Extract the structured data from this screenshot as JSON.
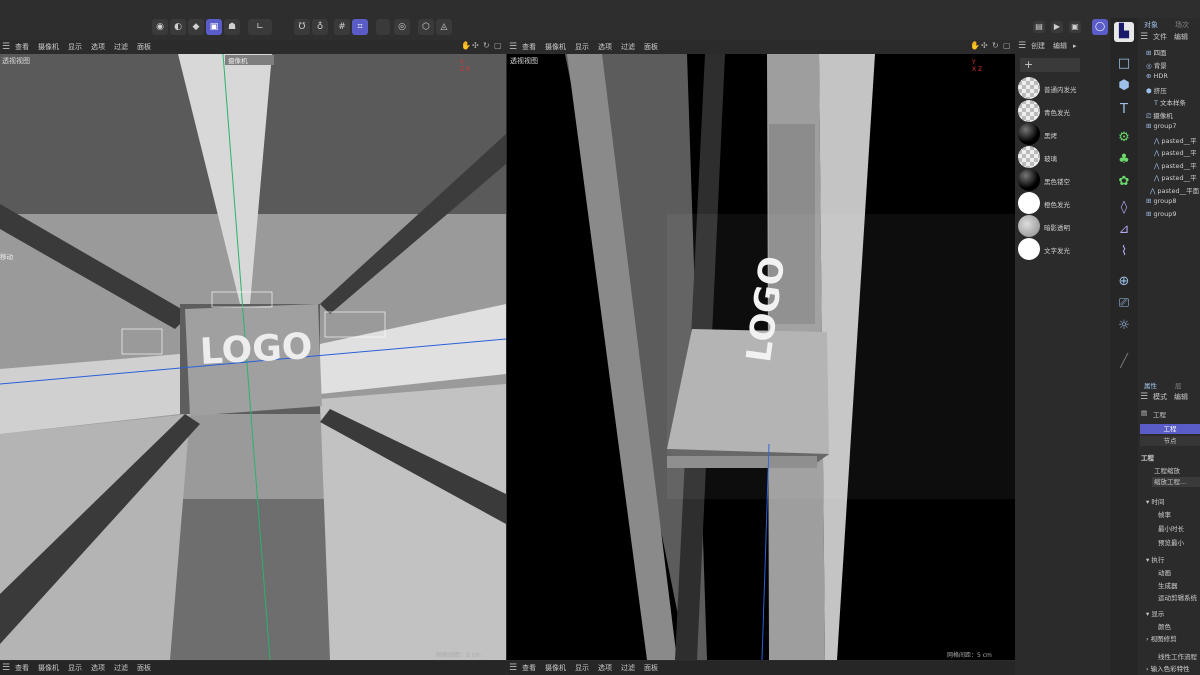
{
  "toolbar": {
    "left_buttons": [
      "◉",
      "◐",
      "◆",
      "▣",
      "☗"
    ],
    "mid_buttons": [
      "∟",
      "Ʊ",
      "♁",
      "#",
      "⌗"
    ],
    "right_buttons": [
      "◧",
      "◎",
      "⬡",
      "◬"
    ]
  },
  "viewport_menu": [
    "查看",
    "摄像机",
    "显示",
    "选项",
    "过滤",
    "面板"
  ],
  "left_viewport": {
    "label": "透视视图",
    "camera_label": "摄像机",
    "move_label": "移动",
    "logo_text": "LOGO",
    "grid_spacing": "网格间距：5 cm"
  },
  "right_viewport": {
    "label": "透视视图",
    "logo_text": "LOGO",
    "grid_spacing": "网格间距：5 cm"
  },
  "material_panel": {
    "menu": [
      "创建",
      "编辑"
    ],
    "materials": [
      {
        "name": "普通内发光",
        "style": "checker"
      },
      {
        "name": "青色发光",
        "style": "checker"
      },
      {
        "name": "黑烤",
        "style": "black"
      },
      {
        "name": "玻璃",
        "style": "checker"
      },
      {
        "name": "黑色镂空",
        "style": "black"
      },
      {
        "name": "橙色发光",
        "style": "white"
      },
      {
        "name": "暗影透明",
        "style": "gray"
      },
      {
        "name": "文字发光",
        "style": "white"
      }
    ]
  },
  "object_manager": {
    "tabs": [
      "对象",
      "场次"
    ],
    "menu": [
      "文件",
      "编辑"
    ],
    "items": [
      "四面",
      "背景",
      "HDR",
      "挤压",
      "文本样条",
      "摄像机",
      "group7",
      "pasted__平",
      "pasted__平",
      "pasted__平",
      "pasted__平",
      "pasted__平面",
      "group8",
      "group9"
    ]
  },
  "attributes": {
    "tabs": [
      "属性",
      "层"
    ],
    "menu": [
      "模式",
      "编辑"
    ],
    "project_label": "工程",
    "tab_project": "工程",
    "tab_nodes": "节点",
    "section_title": "工程",
    "project_scale": "工程缩放",
    "scale_button": "缩放工程...",
    "time_section": "时间",
    "fps": "帧率",
    "min_len": "最小时长",
    "preview_min": "预览最小",
    "exec_section": "执行",
    "animation": "动画",
    "generators": "生成器",
    "motion_system": "运动剪辑系统",
    "display_section": "显示",
    "color": "颜色",
    "view_clip": "视图修剪",
    "linear_workflow": "线性工作流程",
    "input_color": "输入色彩特性"
  },
  "bottom_menu": [
    "查看",
    "摄像机",
    "显示",
    "选项",
    "过滤",
    "面板"
  ],
  "colors": {
    "accent": "#5a5cc8",
    "icon_blue": "#9ec0e8"
  }
}
